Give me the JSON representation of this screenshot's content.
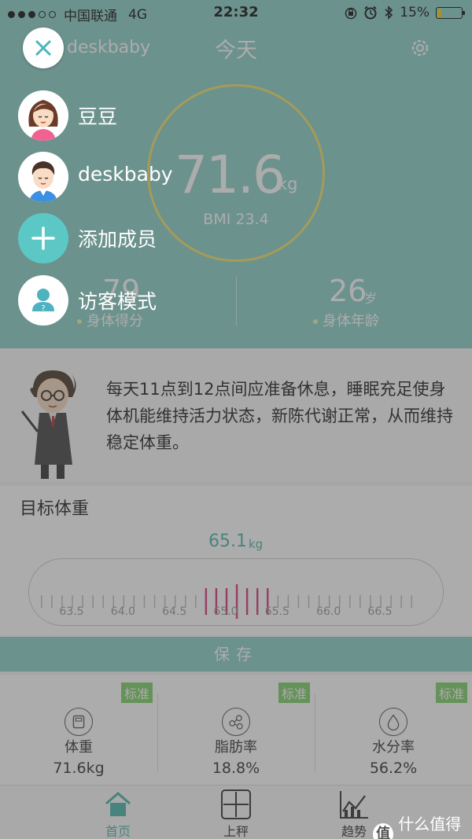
{
  "status_bar": {
    "carrier": "中国联通",
    "network": "4G",
    "time": "22:32",
    "battery_text": "15%",
    "battery_level": 0.15
  },
  "header": {
    "title": "今天",
    "user": "deskbaby"
  },
  "summary": {
    "weight_value": "71.6",
    "weight_unit": "kg",
    "bmi": "BMI 23.4",
    "score_value": "79",
    "score_label": "身体得分",
    "age_value": "26",
    "age_unit": "岁",
    "age_label": "身体年龄"
  },
  "tip": {
    "text": "每天11点到12点间应准备休息，睡眠充足使身体机能维持活力状态，新陈代谢正常，从而维持稳定体重。"
  },
  "goal": {
    "title": "目标体重",
    "value": "65.1",
    "unit": "kg",
    "ticks": [
      "63.5",
      "64.0",
      "64.5",
      "65.0",
      "65.5",
      "66.0",
      "66.5"
    ]
  },
  "save_label": "保存",
  "metrics": [
    {
      "label": "体重",
      "value": "71.6kg",
      "badge": "标准"
    },
    {
      "label": "脂肪率",
      "value": "18.8%",
      "badge": "标准"
    },
    {
      "label": "水分率",
      "value": "56.2%",
      "badge": "标准"
    }
  ],
  "tabs": [
    {
      "label": "首页"
    },
    {
      "label": "上秤"
    },
    {
      "label": "趋势"
    }
  ],
  "menu": {
    "members": [
      {
        "name": "豆豆"
      },
      {
        "name": "deskbaby"
      }
    ],
    "add_member": "添加成员",
    "guest_mode": "访客模式"
  },
  "watermark": {
    "logo": "值",
    "text": "什么值得买"
  },
  "colors": {
    "accent": "#8ad0c7",
    "badge": "#7fcf68",
    "ruler_pink": "#d8387a"
  }
}
